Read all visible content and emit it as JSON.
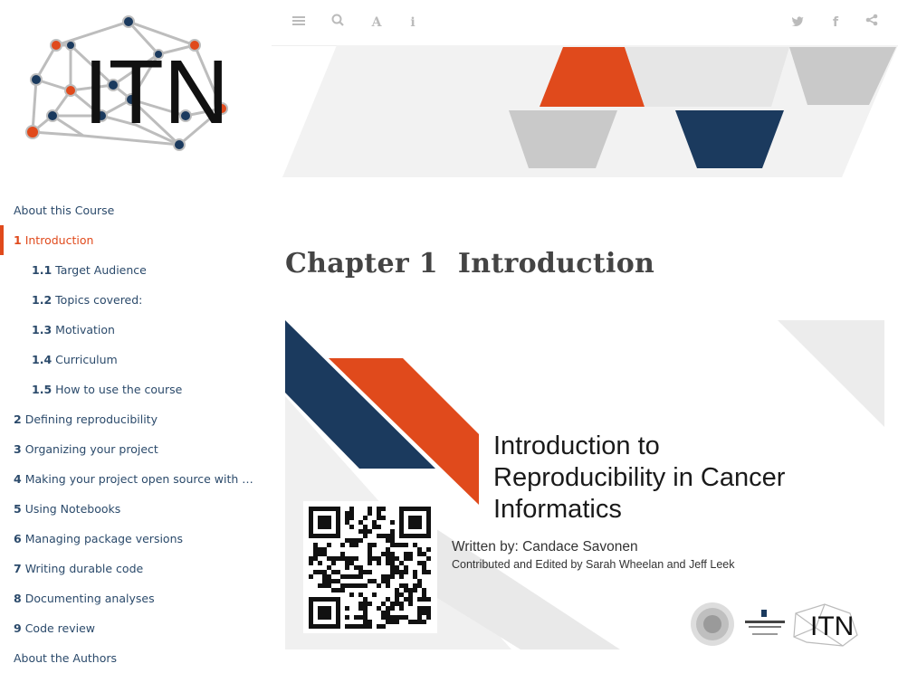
{
  "sidebar": {
    "logo_text": "ITN",
    "items": [
      {
        "num": "",
        "label": "About this Course",
        "sub": false,
        "active": false
      },
      {
        "num": "1",
        "label": "Introduction",
        "sub": false,
        "active": true
      },
      {
        "num": "1.1",
        "label": "Target Audience",
        "sub": true,
        "active": false
      },
      {
        "num": "1.2",
        "label": "Topics covered:",
        "sub": true,
        "active": false
      },
      {
        "num": "1.3",
        "label": "Motivation",
        "sub": true,
        "active": false
      },
      {
        "num": "1.4",
        "label": "Curriculum",
        "sub": true,
        "active": false
      },
      {
        "num": "1.5",
        "label": "How to use the course",
        "sub": true,
        "active": false
      },
      {
        "num": "2",
        "label": "Defining reproducibility",
        "sub": false,
        "active": false
      },
      {
        "num": "3",
        "label": "Organizing your project",
        "sub": false,
        "active": false
      },
      {
        "num": "4",
        "label": "Making your project open source with …",
        "sub": false,
        "active": false
      },
      {
        "num": "5",
        "label": "Using Notebooks",
        "sub": false,
        "active": false
      },
      {
        "num": "6",
        "label": "Managing package versions",
        "sub": false,
        "active": false
      },
      {
        "num": "7",
        "label": "Writing durable code",
        "sub": false,
        "active": false
      },
      {
        "num": "8",
        "label": "Documenting analyses",
        "sub": false,
        "active": false
      },
      {
        "num": "9",
        "label": "Code review",
        "sub": false,
        "active": false
      },
      {
        "num": "",
        "label": "About the Authors",
        "sub": false,
        "active": false
      }
    ]
  },
  "toolbar": {
    "left": [
      "list-icon",
      "search-icon",
      "font-icon",
      "info-icon"
    ],
    "right": [
      "twitter-icon",
      "facebook-icon",
      "share-icon"
    ]
  },
  "main": {
    "chapter_label": "Chapter 1",
    "chapter_title": "Introduction"
  },
  "slide": {
    "title_lines": [
      "Introduction to",
      "Reproducibility in Cancer",
      "Informatics"
    ],
    "author": "Written by: Candace Savonen",
    "contrib": "Contributed and Edited by Sarah Wheelan and Jeff Leek",
    "logo_itn": "ITN"
  },
  "colors": {
    "accent": "#e04a1c",
    "navy": "#1b3a5e",
    "link": "#2b4a6b",
    "grey": "#cfcfcf"
  }
}
